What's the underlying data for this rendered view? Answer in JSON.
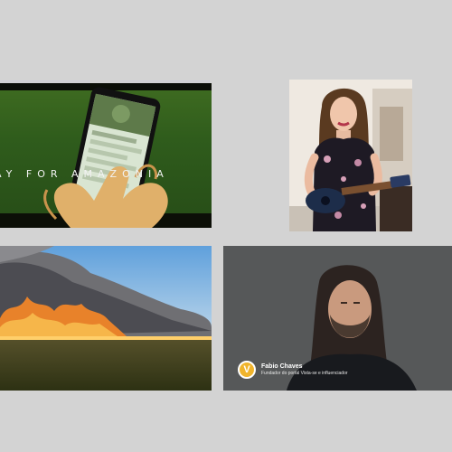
{
  "tiles": {
    "pray": {
      "caption": "AY FOR AMAZONIA"
    },
    "singer": {},
    "fire": {},
    "speaker": {
      "logo_letter": "V",
      "name": "Fabio Chaves",
      "role": "Fundador do portal Vista-se e influenciador"
    }
  },
  "colors": {
    "background": "#d3d3d3",
    "pray_green": "#2f5c1c",
    "logo_yellow": "#f0b42c",
    "speaker_bg": "#565859"
  },
  "icons": [
    "v-logo-icon"
  ]
}
